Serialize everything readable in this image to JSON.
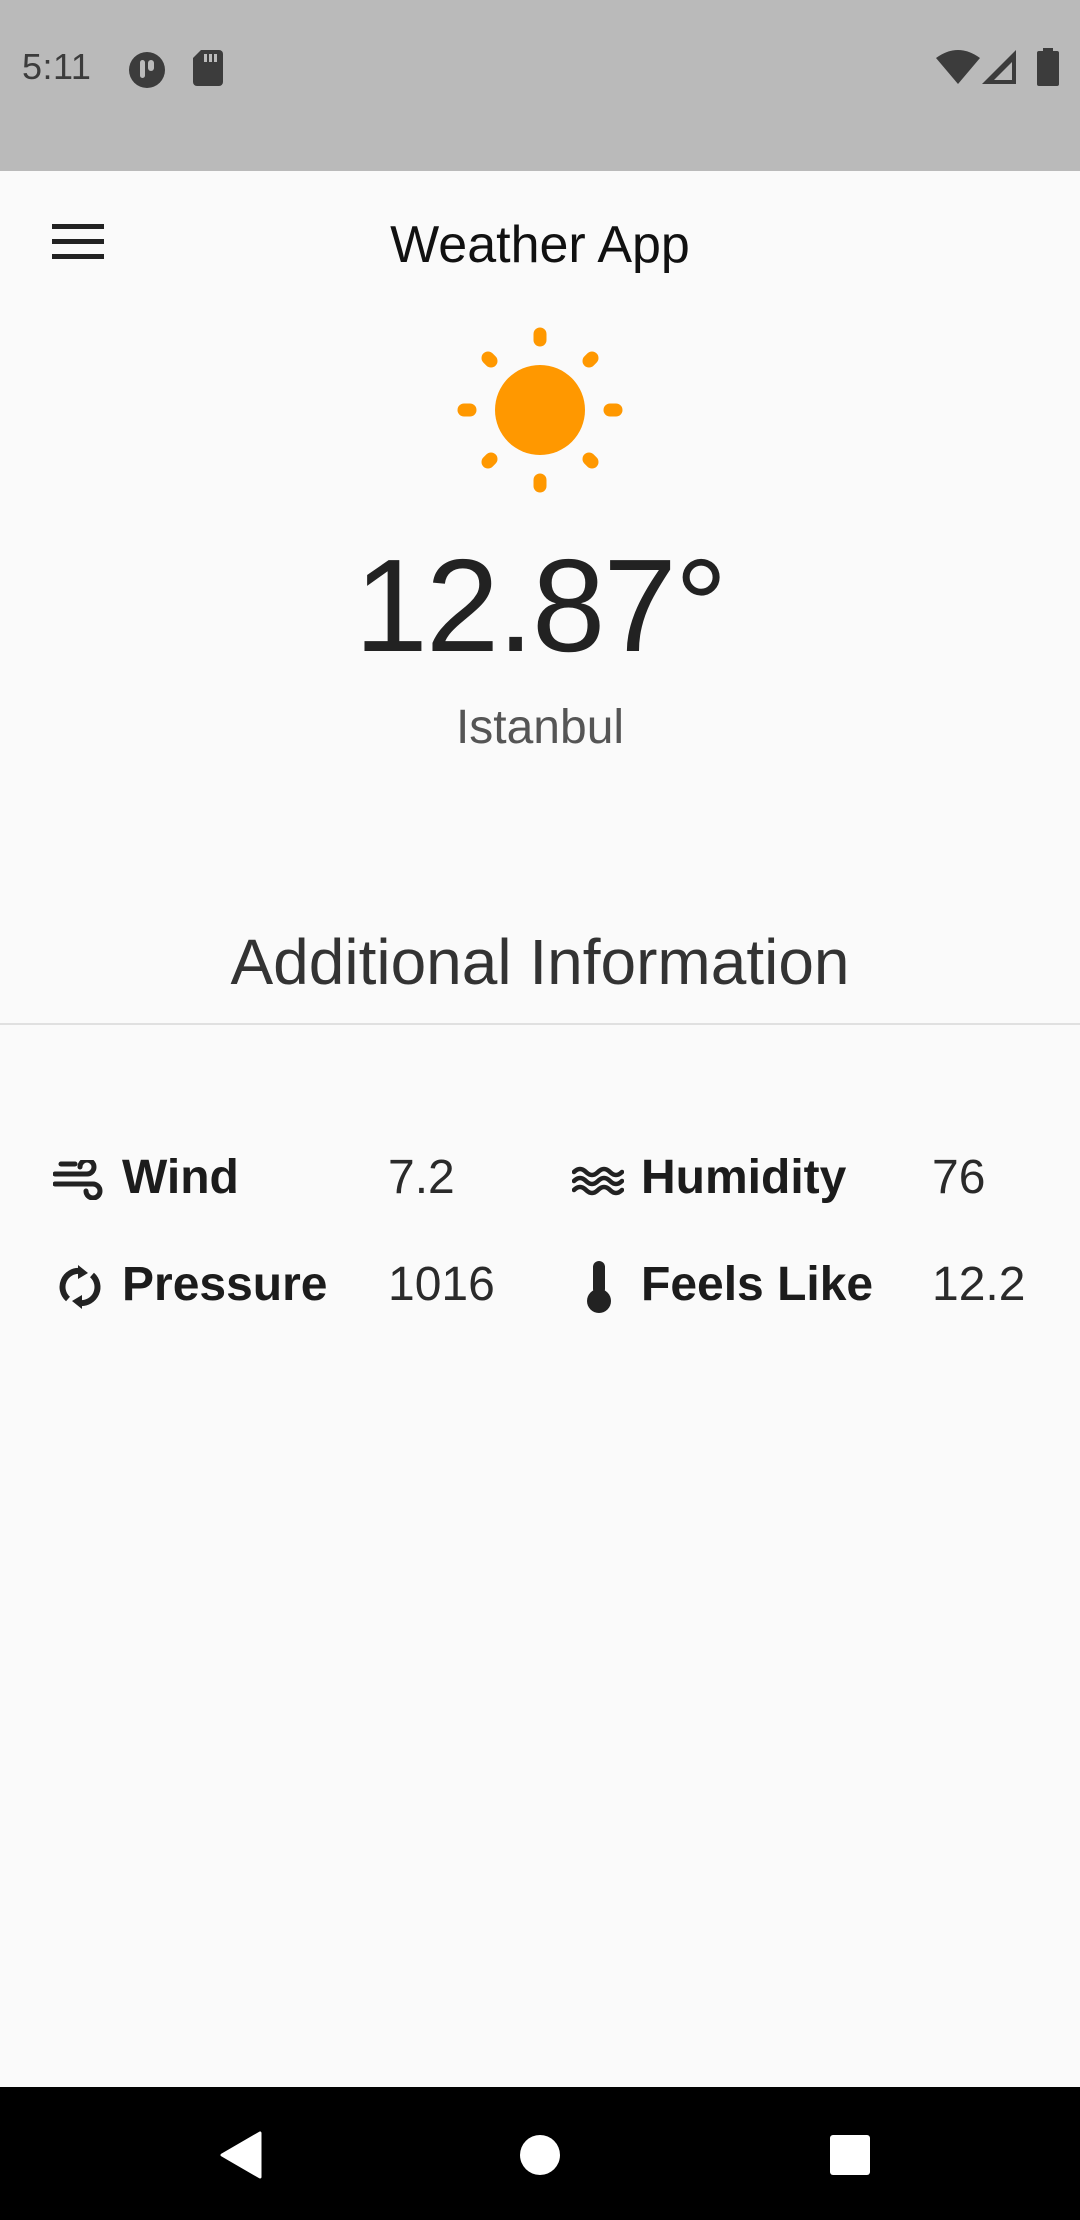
{
  "status_bar": {
    "time": "5:11",
    "icons": [
      "tracking-icon",
      "sd-card-icon",
      "wifi-icon",
      "signal-icon",
      "battery-icon"
    ]
  },
  "app_bar": {
    "title": "Weather App",
    "menu_icon": "hamburger-menu-icon"
  },
  "weather": {
    "condition_icon": "sun-icon",
    "temperature": "12.87°",
    "city": "Istanbul"
  },
  "additional": {
    "title": "Additional Information",
    "items": [
      {
        "icon": "wind-icon",
        "label": "Wind",
        "value": "7.2"
      },
      {
        "icon": "humidity-icon",
        "label": "Humidity",
        "value": "76"
      },
      {
        "icon": "pressure-icon",
        "label": "Pressure",
        "value": "1016"
      },
      {
        "icon": "thermometer-icon",
        "label": "Feels Like",
        "value": "12.2"
      }
    ]
  },
  "nav_bar": {
    "icons": [
      "back-icon",
      "home-icon",
      "recents-icon"
    ]
  },
  "colors": {
    "accent_sun": "#ff9800",
    "status_bar_bg": "#bababa",
    "background": "#fafafa",
    "nav_bar_bg": "#000000"
  }
}
